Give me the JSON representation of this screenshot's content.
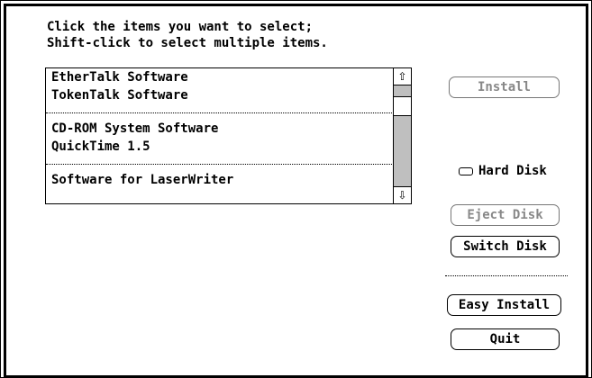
{
  "instructions": {
    "line1": "Click the items you want to select;",
    "line2": "Shift-click to select multiple items."
  },
  "list": {
    "groups": [
      {
        "items": [
          "EtherTalk Software",
          "TokenTalk Software"
        ]
      },
      {
        "items": [
          "CD-ROM System Software",
          "QuickTime 1.5"
        ]
      },
      {
        "items": [
          "Software for LaserWriter"
        ]
      }
    ]
  },
  "scrollbar": {
    "up_glyph": "⇧",
    "down_glyph": "⇩"
  },
  "buttons": {
    "install": "Install",
    "eject": "Eject Disk",
    "switch": "Switch Disk",
    "easy_install": "Easy Install",
    "quit": "Quit"
  },
  "disk": {
    "name": "Hard Disk"
  }
}
